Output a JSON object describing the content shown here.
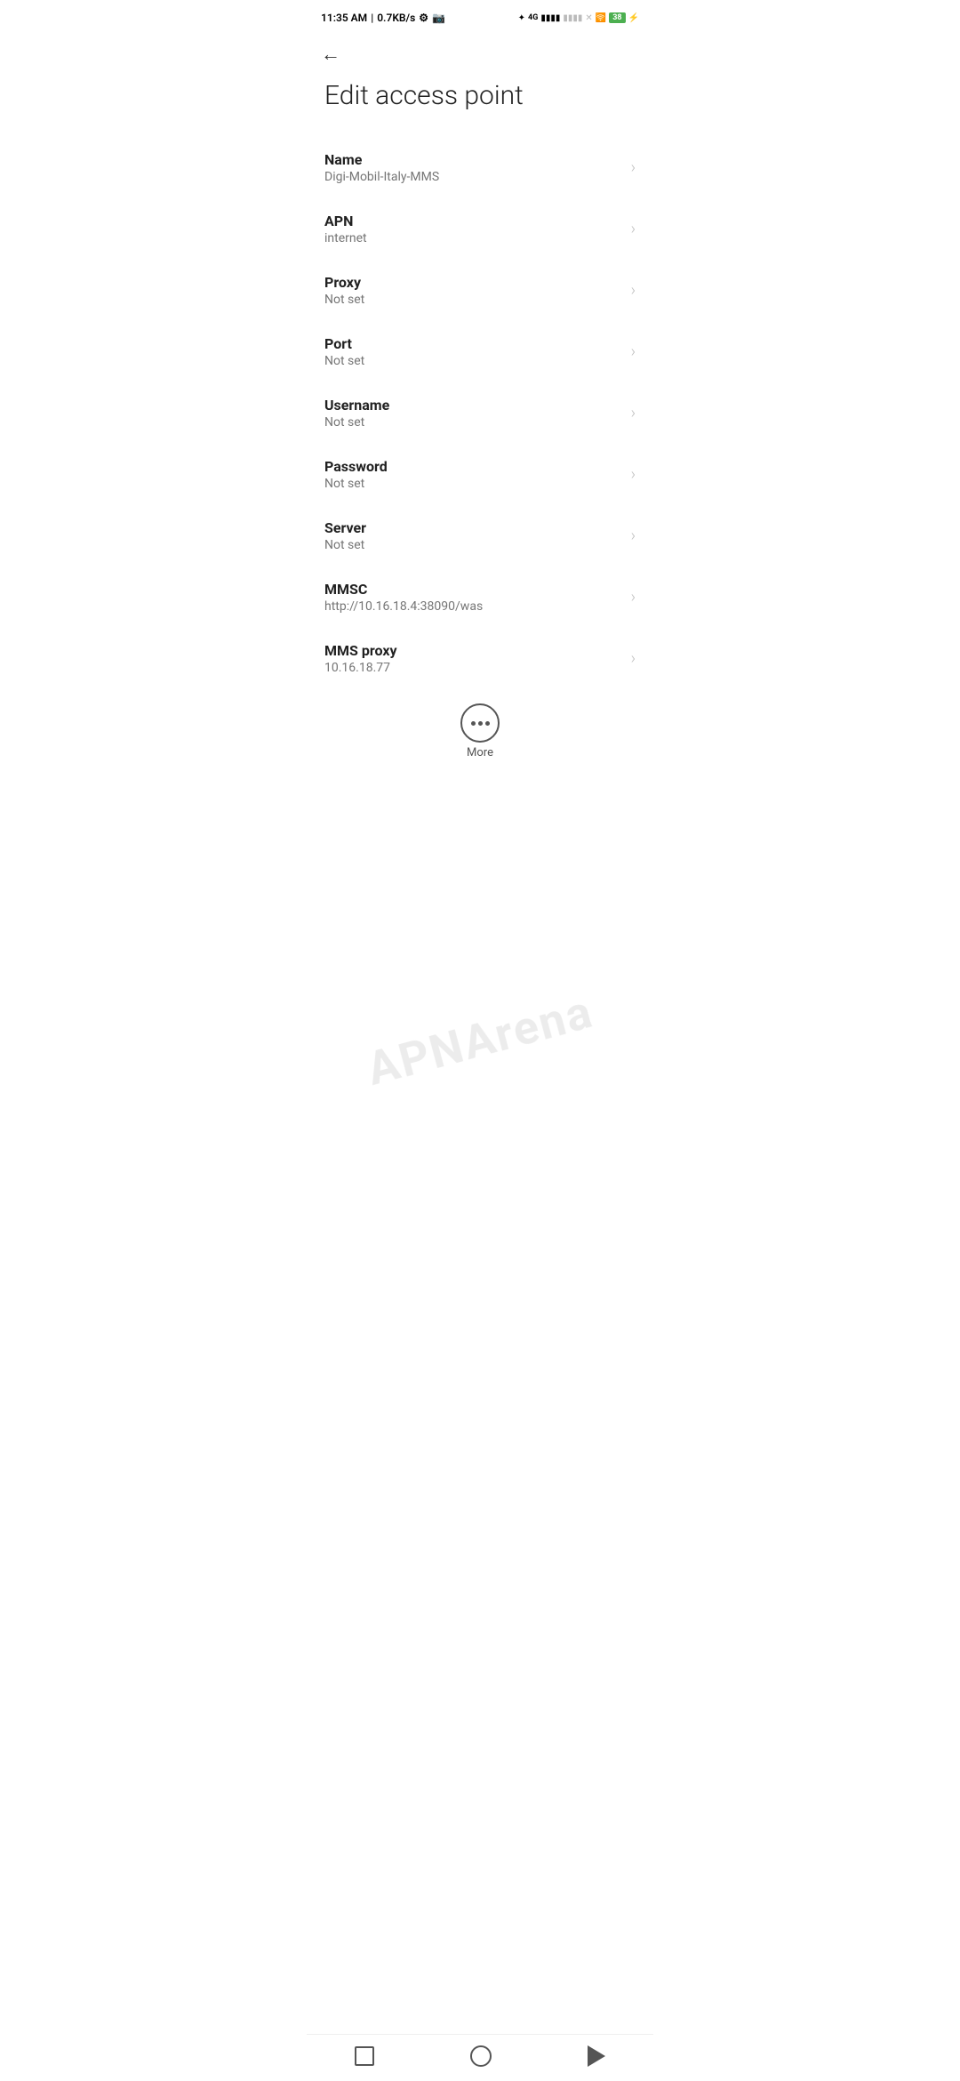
{
  "statusBar": {
    "time": "11:35 AM",
    "network": "0.7KB/s",
    "battery": "38",
    "batterySymbol": "⚡"
  },
  "page": {
    "title": "Edit access point"
  },
  "fields": [
    {
      "label": "Name",
      "value": "Digi-Mobil-Italy-MMS"
    },
    {
      "label": "APN",
      "value": "internet"
    },
    {
      "label": "Proxy",
      "value": "Not set"
    },
    {
      "label": "Port",
      "value": "Not set"
    },
    {
      "label": "Username",
      "value": "Not set"
    },
    {
      "label": "Password",
      "value": "Not set"
    },
    {
      "label": "Server",
      "value": "Not set"
    },
    {
      "label": "MMSC",
      "value": "http://10.16.18.4:38090/was"
    },
    {
      "label": "MMS proxy",
      "value": "10.16.18.77"
    }
  ],
  "more": {
    "label": "More"
  },
  "watermark": "APNArena"
}
